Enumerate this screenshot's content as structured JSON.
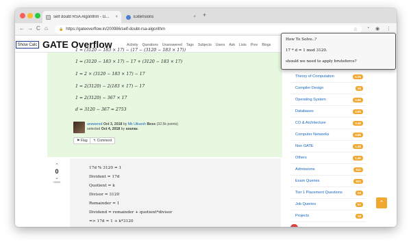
{
  "browser": {
    "tabs": [
      {
        "title": "self doubt RSA Algorithm - G...",
        "close": "×"
      },
      {
        "title": "Extensions",
        "close": "×"
      }
    ],
    "new_tab": "+",
    "nav": {
      "back": "←",
      "forward": "→",
      "reload": "C",
      "home": "⌂"
    },
    "url": "https://gateoverflow.in/200986/self-doubt-rsa-algorithm",
    "lock": "🔒",
    "star": "☆"
  },
  "site": {
    "show_calc": "Show Calc",
    "logo": "GATE Overflow",
    "nav": [
      "Activity",
      "Questions",
      "Unanswered",
      "Tags",
      "Subjects",
      "Users",
      "Ask",
      "Lists",
      "Prev",
      "Blogs"
    ]
  },
  "answer1": {
    "lines": [
      "1 = (3120 − 183 × 17) − (17 − (3120 − 183 × 17))",
      "1 = (3120 − 183 × 17) − 17 + (3120 − 183 × 17)",
      "1 = 2 × (3120 − 183 × 17) − 17",
      "1 = 2(3120) − 2(183 × 17) − 17",
      "1 = 2(3120) − 367 × 17",
      "d = 3120 − 367 = 2753"
    ],
    "meta_prefix": "answered",
    "meta_date": "Oct 3, 2018",
    "meta_by": "by",
    "meta_user": "Mk Utkarsh",
    "meta_badge": "Boss",
    "meta_points": "(32.5k points)",
    "selected_prefix": "selected",
    "selected_date": "Oct 4, 2018",
    "selected_by": "by",
    "selected_user": "sourav.",
    "flag_label": "⚑ Flag",
    "comment_label": "↰ Comment"
  },
  "answer2": {
    "vote_up": "⌃",
    "vote_count": "0",
    "vote_down": "⌄",
    "votes_label": "votes",
    "lines": [
      "17d % 3120 = 1",
      "Divident = 17d",
      "Quotient = k",
      "Divisor = 3120",
      "Remainder = 1",
      "Dividend = remainder + quotient*divisor",
      "=> 17d = 1 + k*3120"
    ]
  },
  "sidebar": {
    "categories": [
      {
        "label": "Theory of Computation",
        "count": "5.2k"
      },
      {
        "label": "Compiler Design",
        "count": "2k"
      },
      {
        "label": "Operating System",
        "count": "3.9k"
      },
      {
        "label": "Databases",
        "count": "3.9k"
      },
      {
        "label": "CO & Architecture",
        "count": "3.4k"
      },
      {
        "label": "Computer Networks",
        "count": "3.8k"
      },
      {
        "label": "Non GATE",
        "count": "1.4k"
      },
      {
        "label": "Others",
        "count": "1.4k"
      },
      {
        "label": "Admissions",
        "count": "512"
      },
      {
        "label": "Exam Queries",
        "count": "521"
      },
      {
        "label": "Tier 1 Placement Questions",
        "count": "23"
      },
      {
        "label": "Job Queries",
        "count": "57"
      },
      {
        "label": "Projects",
        "count": "18"
      }
    ]
  },
  "popup": {
    "lines": [
      "How To Solve..?",
      "17 * d  = 1 mod 3120.",
      "should we need to apply bruteforce?"
    ]
  },
  "scroll_top": "⌃",
  "colors": {
    "accent": "#f0a830",
    "answer_bg": "#e7f7e0",
    "link": "#1565c0"
  }
}
